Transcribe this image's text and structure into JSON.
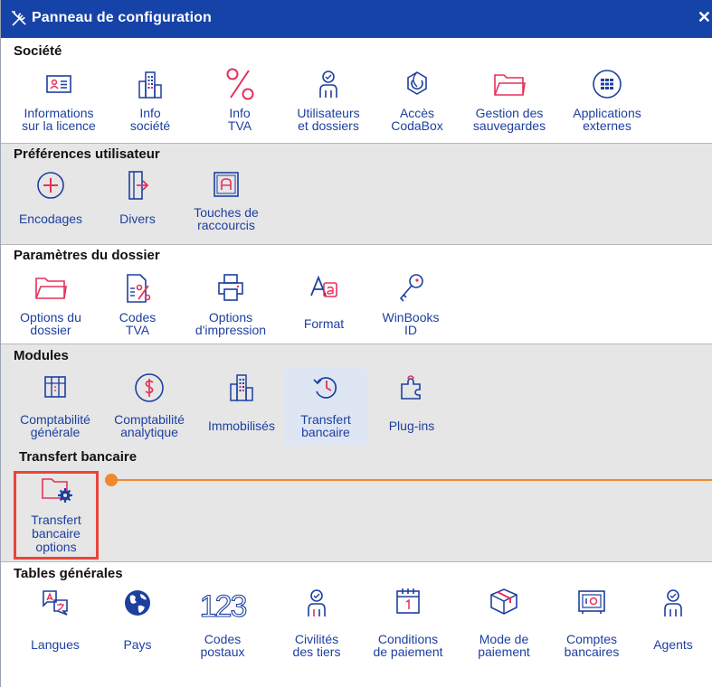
{
  "window": {
    "title": "Panneau de configuration",
    "close_glyph": "✕"
  },
  "colors": {
    "titlebar": "#1643a8",
    "icon_blue": "#1d3fa0",
    "icon_red": "#e5315a",
    "accent_orange": "#f0882c",
    "highlight_red": "#e8453c"
  },
  "sections": {
    "societe": {
      "title": "Société",
      "items": [
        {
          "label1": "Informations",
          "label2": "sur la licence",
          "icon": "license-card-icon"
        },
        {
          "label1": "Info",
          "label2": "société",
          "icon": "building-icon"
        },
        {
          "label1": "Info",
          "label2": "TVA",
          "icon": "percent-icon"
        },
        {
          "label1": "Utilisateurs",
          "label2": "et dossiers",
          "icon": "users-icon"
        },
        {
          "label1": "Accès",
          "label2": "CodaBox",
          "icon": "codabox-icon"
        },
        {
          "label1": "Gestion des",
          "label2": "sauvegardes",
          "icon": "folder-icon"
        },
        {
          "label1": "Applications",
          "label2": "externes",
          "icon": "apps-grid-icon"
        }
      ]
    },
    "preferences": {
      "title": "Préférences utilisateur",
      "items": [
        {
          "label1": "Encodages",
          "label2": "",
          "icon": "plus-circle-icon"
        },
        {
          "label1": "Divers",
          "label2": "",
          "icon": "export-document-icon"
        },
        {
          "label1": "Touches de",
          "label2": "raccourcis",
          "icon": "shortcut-key-icon"
        }
      ]
    },
    "parametres": {
      "title": "Paramètres du dossier",
      "items": [
        {
          "label1": "Options du",
          "label2": "dossier",
          "icon": "folder-icon"
        },
        {
          "label1": "Codes",
          "label2": "TVA",
          "icon": "vat-codes-icon"
        },
        {
          "label1": "Options",
          "label2": "d'impression",
          "icon": "printer-icon"
        },
        {
          "label1": "Format",
          "label2": "",
          "icon": "font-format-icon"
        },
        {
          "label1": "WinBooks",
          "label2": "ID",
          "icon": "key-icon"
        }
      ]
    },
    "modules": {
      "title": "Modules",
      "items": [
        {
          "label1": "Comptabilité",
          "label2": "générale",
          "icon": "ledger-icon"
        },
        {
          "label1": "Comptabilité",
          "label2": "analytique",
          "icon": "dollar-circle-icon"
        },
        {
          "label1": "Immobilisés",
          "label2": "",
          "icon": "building-icon"
        },
        {
          "label1": "Transfert",
          "label2": "bancaire",
          "icon": "history-icon"
        },
        {
          "label1": "Plug-ins",
          "label2": "",
          "icon": "puzzle-icon"
        }
      ]
    },
    "transfert": {
      "title": "Transfert bancaire",
      "items": [
        {
          "label1": "Transfert",
          "label2": "bancaire",
          "label3": "options",
          "icon": "folder-gear-icon"
        }
      ]
    },
    "tables": {
      "title": "Tables générales",
      "items": [
        {
          "label1": "Langues",
          "label2": "",
          "icon": "language-icon"
        },
        {
          "label1": "Pays",
          "label2": "",
          "icon": "globe-icon"
        },
        {
          "label1": "Codes",
          "label2": "postaux",
          "icon": "numbers-123-icon"
        },
        {
          "label1": "Civilités",
          "label2": "des tiers",
          "icon": "person-icon"
        },
        {
          "label1": "Conditions",
          "label2": "de paiement",
          "icon": "calendar-icon"
        },
        {
          "label1": "Mode de",
          "label2": "paiement",
          "icon": "package-icon"
        },
        {
          "label1": "Comptes",
          "label2": "bancaires",
          "icon": "safe-icon"
        },
        {
          "label1": "Agents",
          "label2": "",
          "icon": "agent-icon"
        }
      ]
    }
  }
}
